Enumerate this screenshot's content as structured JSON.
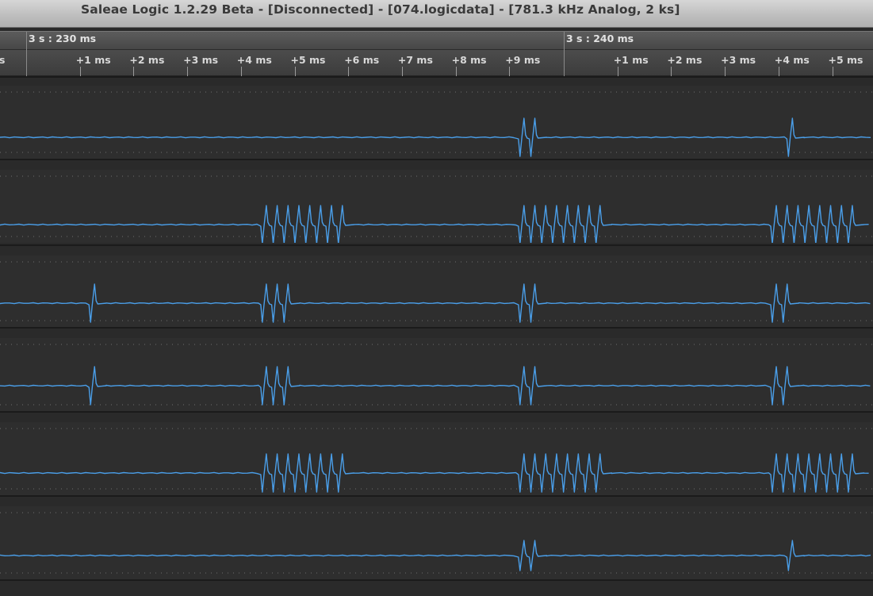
{
  "window": {
    "title": "Saleae Logic 1.2.29 Beta - [Disconnected] - [074.logicdata] - [781.3 kHz Analog, 2 ks]"
  },
  "timeline": {
    "major_labels": [
      "3 s : 230 ms",
      "3 s : 240 ms"
    ],
    "edge_label": "s",
    "ticks_first_segment": [
      "+1 ms",
      "+2 ms",
      "+3 ms",
      "+4 ms",
      "+5 ms",
      "+6 ms",
      "+7 ms",
      "+8 ms",
      "+9 ms"
    ],
    "ticks_second_segment": [
      "+1 ms",
      "+2 ms",
      "+3 ms",
      "+4 ms",
      "+5 ms"
    ]
  },
  "colors": {
    "trace": "#4a9ee8",
    "grid_dots": "#6f6f6f",
    "channel_bg": "#2e2e2e",
    "separator": "#1b1b1b"
  },
  "channels": [
    {
      "bursts": [
        {
          "t_ms": 9.2,
          "pulses": 2
        },
        {
          "t_ms": 14.2,
          "pulses": 1
        }
      ]
    },
    {
      "bursts": [
        {
          "t_ms": 4.4,
          "pulses": 8
        },
        {
          "t_ms": 9.2,
          "pulses": 8
        },
        {
          "t_ms": 13.9,
          "pulses": 8
        }
      ]
    },
    {
      "bursts": [
        {
          "t_ms": 1.2,
          "pulses": 1
        },
        {
          "t_ms": 4.4,
          "pulses": 3
        },
        {
          "t_ms": 9.2,
          "pulses": 2
        },
        {
          "t_ms": 13.9,
          "pulses": 2
        }
      ]
    },
    {
      "bursts": [
        {
          "t_ms": 1.2,
          "pulses": 1
        },
        {
          "t_ms": 4.4,
          "pulses": 3
        },
        {
          "t_ms": 9.2,
          "pulses": 2
        },
        {
          "t_ms": 13.9,
          "pulses": 2
        }
      ]
    },
    {
      "bursts": [
        {
          "t_ms": 4.4,
          "pulses": 8
        },
        {
          "t_ms": 9.2,
          "pulses": 8
        },
        {
          "t_ms": 13.9,
          "pulses": 8
        }
      ]
    },
    {
      "bursts": [
        {
          "t_ms": 9.2,
          "pulses": 2
        },
        {
          "t_ms": 14.2,
          "pulses": 1
        }
      ]
    }
  ]
}
